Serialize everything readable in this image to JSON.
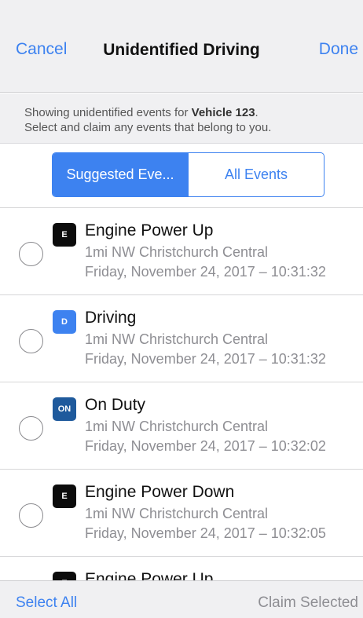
{
  "nav": {
    "cancel": "Cancel",
    "title": "Unidentified Driving",
    "done": "Done"
  },
  "info": {
    "prefix": "Showing unidentified events for ",
    "vehicle": "Vehicle 123",
    "suffix": ".",
    "line2": "Select and claim any events that belong to you."
  },
  "segment": {
    "suggested": "Suggested Eve...",
    "all": "All Events",
    "selected": "suggested"
  },
  "events": [
    {
      "badge": "E",
      "badge_color": "#0c0c0c",
      "title": "Engine Power Up",
      "location": "1mi NW Christchurch Central",
      "time": "Friday, November 24, 2017 – 10:31:32"
    },
    {
      "badge": "D",
      "badge_color": "#3d82f0",
      "title": "Driving",
      "location": "1mi NW Christchurch Central",
      "time": "Friday, November 24, 2017 – 10:31:32"
    },
    {
      "badge": "ON",
      "badge_color": "#1f5a9c",
      "title": "On Duty",
      "location": "1mi NW Christchurch Central",
      "time": "Friday, November 24, 2017 – 10:32:02"
    },
    {
      "badge": "E",
      "badge_color": "#0c0c0c",
      "title": "Engine Power Down",
      "location": "1mi NW Christchurch Central",
      "time": "Friday, November 24, 2017 – 10:32:05"
    },
    {
      "badge": "E",
      "badge_color": "#0c0c0c",
      "title": "Engine Power Up",
      "location": "",
      "time": ""
    }
  ],
  "toolbar": {
    "select_all": "Select All",
    "claim": "Claim Selected"
  },
  "colors": {
    "accent": "#3d82f0",
    "disabled": "#8e8e93"
  }
}
